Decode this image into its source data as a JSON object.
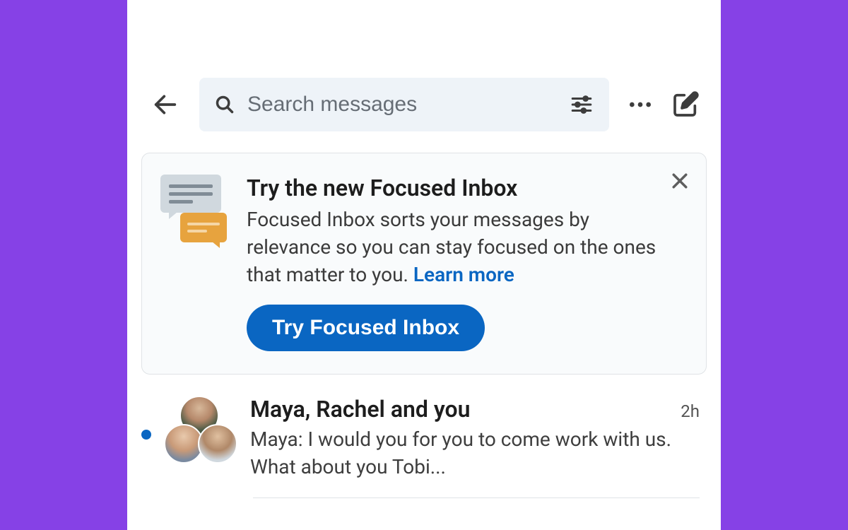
{
  "header": {
    "search_placeholder": "Search messages"
  },
  "promo": {
    "title": "Try the new Focused Inbox",
    "text": "Focused Inbox sorts your messages by relevance so you can stay focused on the ones that matter to you. ",
    "learn_more": "Learn more",
    "cta": "Try Focused Inbox"
  },
  "conversations": [
    {
      "title": "Maya, Rachel and you",
      "time": "2h",
      "preview": "Maya: I would you for you to come work with us. What about you Tobi...",
      "unread": true
    }
  ]
}
